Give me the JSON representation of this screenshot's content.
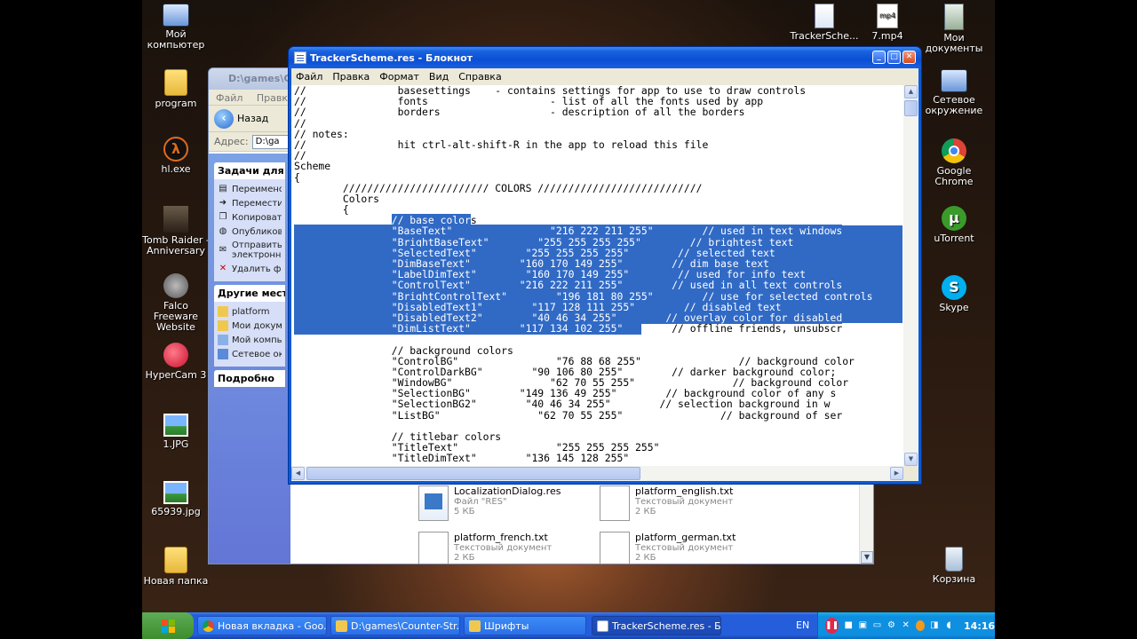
{
  "desktop": {
    "left_icons": [
      {
        "label": "Мой компьютер",
        "icon": "computer-icon"
      },
      {
        "label": "program",
        "icon": "folder-icon"
      },
      {
        "label": "hl.exe",
        "icon": "half-life-icon"
      },
      {
        "label": "Tomb Raider - Anniversary",
        "icon": "tomb-raider-icon"
      },
      {
        "label": "Falco Freeware Website",
        "icon": "falco-icon"
      },
      {
        "label": "HyperCam 3",
        "icon": "hypercam-icon"
      },
      {
        "label": "1.JPG",
        "icon": "image-file-icon"
      },
      {
        "label": "65939.jpg",
        "icon": "image-file-icon"
      },
      {
        "label": "Новая папка",
        "icon": "folder-icon"
      }
    ],
    "right_icons": [
      {
        "label": "TrackerSche...",
        "icon": "res-file-icon"
      },
      {
        "label": "7.mp4",
        "icon": "video-file-icon"
      },
      {
        "label": "Мои документы",
        "icon": "my-documents-icon"
      },
      {
        "label": "Сетевое окружение",
        "icon": "network-icon"
      },
      {
        "label": "Google Chrome",
        "icon": "chrome-icon"
      },
      {
        "label": "uTorrent",
        "icon": "utorrent-icon"
      },
      {
        "label": "Skype",
        "icon": "skype-icon"
      },
      {
        "label": "Корзина",
        "icon": "recycle-bin-icon"
      }
    ]
  },
  "explorer": {
    "title": "D:\\games\\C",
    "menu": [
      "Файл",
      "Правка"
    ],
    "back_label": "Назад",
    "address_label": "Адрес:",
    "address_value": "D:\\ga",
    "tasks_title": "Задачи для фа",
    "tasks": [
      "Переименов",
      "Переместит",
      "Копировать",
      "Опубликова",
      "Отправить электронно",
      "Удалить фа"
    ],
    "places_title": "Другие места",
    "places": [
      "platform",
      "Мои докуме",
      "Мой компью",
      "Сетевое окр"
    ],
    "details_title": "Подробно",
    "files": [
      {
        "name": "LocalizationDialog.res",
        "type": "Файл \"RES\"",
        "size": "5 КБ"
      },
      {
        "name": "platform_english.txt",
        "type": "Текстовый документ",
        "size": "2 КБ"
      },
      {
        "name": "platform_french.txt",
        "type": "Текстовый документ",
        "size": "2 КБ"
      },
      {
        "name": "platform_german.txt",
        "type": "Текстовый документ",
        "size": "2 КБ"
      }
    ]
  },
  "notepad": {
    "title": "TrackerScheme.res - Блокнот",
    "menu": [
      "Файл",
      "Правка",
      "Формат",
      "Вид",
      "Справка"
    ],
    "lines": [
      {
        "text": "//               basesettings    - contains settings for app to use to draw controls",
        "sel_from": -1,
        "sel_to": -1
      },
      {
        "text": "//               fonts                    - list of all the fonts used by app",
        "sel_from": -1,
        "sel_to": -1
      },
      {
        "text": "//               borders                  - description of all the borders",
        "sel_from": -1,
        "sel_to": -1
      },
      {
        "text": "//",
        "sel_from": -1,
        "sel_to": -1
      },
      {
        "text": "// notes:",
        "sel_from": -1,
        "sel_to": -1
      },
      {
        "text": "//               hit ctrl-alt-shift-R in the app to reload this file",
        "sel_from": -1,
        "sel_to": -1
      },
      {
        "text": "//",
        "sel_from": -1,
        "sel_to": -1
      },
      {
        "text": "Scheme",
        "sel_from": -1,
        "sel_to": -1
      },
      {
        "text": "{",
        "sel_from": -1,
        "sel_to": -1
      },
      {
        "text": "        //////////////////////// COLORS ///////////////////////////",
        "sel_from": -1,
        "sel_to": -1
      },
      {
        "text": "        Colors",
        "sel_from": -1,
        "sel_to": -1
      },
      {
        "text": "        {",
        "sel_from": -1,
        "sel_to": -1
      },
      {
        "text": "                // base colors",
        "sel_from": 16,
        "sel_to": 29
      },
      {
        "text": "                \"BaseText\"                \"216 222 211 255\"        // used in text windows",
        "sel_from": 0,
        "sel_to": 999
      },
      {
        "text": "                \"BrightBaseText\"        \"255 255 255 255\"        // brightest text",
        "sel_from": 0,
        "sel_to": 999
      },
      {
        "text": "                \"SelectedText\"        \"255 255 255 255\"        // selected text",
        "sel_from": 0,
        "sel_to": 999
      },
      {
        "text": "                \"DimBaseText\"        \"160 170 149 255\"        // dim base text",
        "sel_from": 0,
        "sel_to": 999
      },
      {
        "text": "                \"LabelDimText\"        \"160 170 149 255\"        // used for info text",
        "sel_from": 0,
        "sel_to": 999
      },
      {
        "text": "                \"ControlText\"        \"216 222 211 255\"        // used in all text controls",
        "sel_from": 0,
        "sel_to": 999
      },
      {
        "text": "                \"BrightControlText\"        \"196 181 80 255\"        // use for selected controls",
        "sel_from": 0,
        "sel_to": 999
      },
      {
        "text": "                \"DisabledText1\"        \"117 128 111 255\"        // disabled text",
        "sel_from": 0,
        "sel_to": 999
      },
      {
        "text": "                \"DisabledText2\"        \"40 46 34 255\"        // overlay color for disabled",
        "sel_from": 0,
        "sel_to": 999
      },
      {
        "text": "                \"DimListText\"        \"117 134 102 255\"        // offline friends, unsubscr",
        "sel_from": 0,
        "sel_to": 57
      },
      {
        "text": "",
        "sel_from": -1,
        "sel_to": -1
      },
      {
        "text": "                // background colors",
        "sel_from": -1,
        "sel_to": -1
      },
      {
        "text": "                \"ControlBG\"                \"76 88 68 255\"                // background color",
        "sel_from": -1,
        "sel_to": -1
      },
      {
        "text": "                \"ControlDarkBG\"        \"90 106 80 255\"        // darker background color;",
        "sel_from": -1,
        "sel_to": -1
      },
      {
        "text": "                \"WindowBG\"                \"62 70 55 255\"                // background color",
        "sel_from": -1,
        "sel_to": -1
      },
      {
        "text": "                \"SelectionBG\"        \"149 136 49 255\"        // background color of any s",
        "sel_from": -1,
        "sel_to": -1
      },
      {
        "text": "                \"SelectionBG2\"        \"40 46 34 255\"        // selection background in w",
        "sel_from": -1,
        "sel_to": -1
      },
      {
        "text": "                \"ListBG\"                \"62 70 55 255\"                // background of ser",
        "sel_from": -1,
        "sel_to": -1
      },
      {
        "text": "",
        "sel_from": -1,
        "sel_to": -1
      },
      {
        "text": "                // titlebar colors",
        "sel_from": -1,
        "sel_to": -1
      },
      {
        "text": "                \"TitleText\"                \"255 255 255 255\"",
        "sel_from": -1,
        "sel_to": -1
      },
      {
        "text": "                \"TitleDimText\"        \"136 145 128 255\"",
        "sel_from": -1,
        "sel_to": -1
      }
    ]
  },
  "taskbar": {
    "start_label": "",
    "buttons": [
      {
        "label": "Новая вкладка - Goo...",
        "icon": "chrome-icon",
        "color": "#e8b430"
      },
      {
        "label": "D:\\games\\Counter-Str...",
        "icon": "folder-icon",
        "color": "#f0c850"
      },
      {
        "label": "Шрифты",
        "icon": "folder-icon",
        "color": "#f0c850"
      },
      {
        "label": "TrackerScheme.res - Б...",
        "icon": "notepad-icon",
        "color": "#ffffff"
      }
    ],
    "language": "EN",
    "clock": "14:16"
  },
  "colors": {
    "selection": "#316ac5",
    "titlebar": "#0a4fd4",
    "taskbar": "#245edb",
    "tray": "#0f8fe0"
  }
}
